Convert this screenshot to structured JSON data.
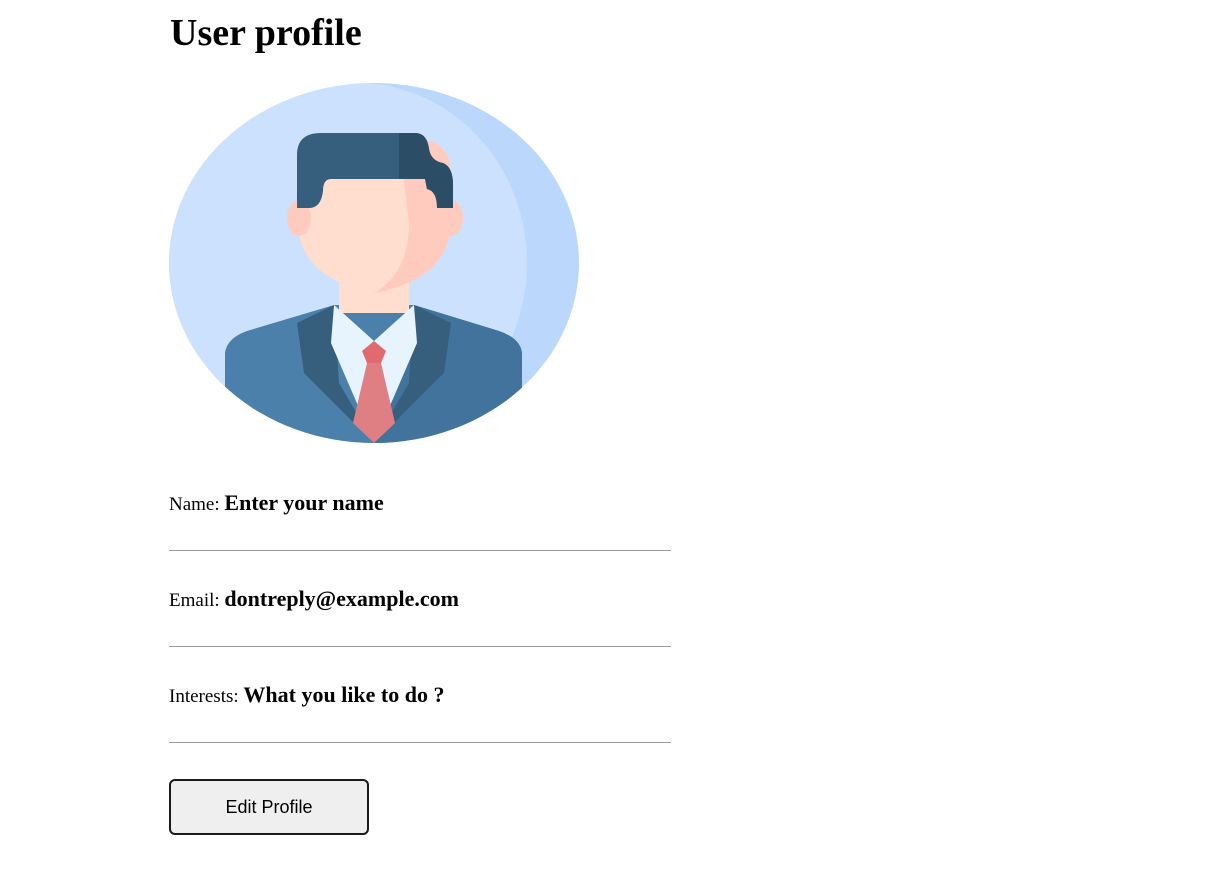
{
  "page": {
    "title": "User profile"
  },
  "profile": {
    "avatar_icon": "person-in-suit-avatar",
    "fields": {
      "name": {
        "label": "Name:",
        "value": "Enter your name"
      },
      "email": {
        "label": "Email:",
        "value": "dontreply@example.com"
      },
      "interests": {
        "label": "Interests:",
        "value": "What you like to do ?"
      }
    },
    "edit_button_label": "Edit Profile"
  },
  "colors": {
    "avatar_bg_light": "#cce1fd",
    "avatar_bg_dark": "#bbd7fc",
    "hair": "#365e7d",
    "skin": "#ffddcf",
    "suit": "#4a80aa",
    "tie": "#e07f83"
  }
}
